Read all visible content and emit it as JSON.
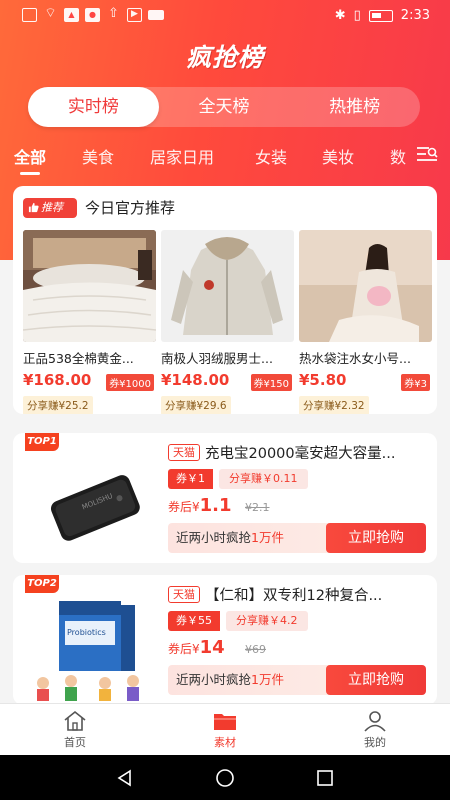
{
  "status": {
    "time": "2:33"
  },
  "app": {
    "title": "疯抢榜"
  },
  "segments": [
    "实时榜",
    "全天榜",
    "热推榜"
  ],
  "categories": [
    "全部",
    "美食",
    "居家日用",
    "女装",
    "美妆",
    "数"
  ],
  "recommend": {
    "badge": "推荐",
    "title": "今日官方推荐",
    "products": [
      {
        "name": "正品538全棉黄金...",
        "price": "¥168.00",
        "coupon": "券¥1000",
        "share": "分享赚¥25.2"
      },
      {
        "name": "南极人羽绒服男士...",
        "price": "¥148.00",
        "coupon": "券¥150",
        "share": "分享赚¥29.6"
      },
      {
        "name": "热水袋注水女小号...",
        "price": "¥5.80",
        "coupon": "券¥3",
        "share": "分享赚¥2.32"
      }
    ]
  },
  "list": [
    {
      "rank": "TOP1",
      "platform": "天猫",
      "title": "充电宝20000毫安超大容量...",
      "coupon": "券￥1",
      "share": "分享赚￥0.11",
      "after_label": "券后¥",
      "after_price": "1.1",
      "orig_price": "¥2.1",
      "sold_prefix": "近两小时疯抢",
      "sold_count": "1万件",
      "buy": "立即抢购",
      "product_brand": "MOLISHU"
    },
    {
      "rank": "TOP2",
      "platform": "天猫",
      "title": "【仁和】双专利12种复合...",
      "coupon": "券￥55",
      "share": "分享赚￥4.2",
      "after_label": "券后¥",
      "after_price": "14",
      "orig_price": "¥69",
      "sold_prefix": "近两小时疯抢",
      "sold_count": "1万件",
      "buy": "立即抢购",
      "product_brand": "Probiotics"
    }
  ],
  "tabs": [
    "首页",
    "素材",
    "我的"
  ]
}
